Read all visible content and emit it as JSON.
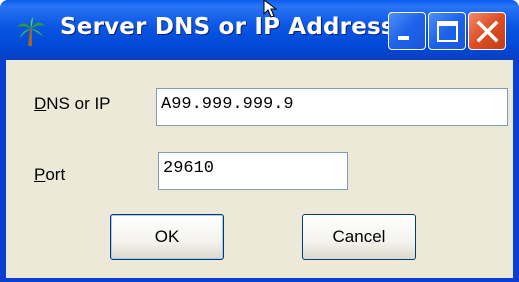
{
  "window": {
    "title": "Server DNS or IP Address",
    "icon": "palm-tree-icon"
  },
  "titlebar_buttons": {
    "minimize": "minimize-icon",
    "maximize": "maximize-icon",
    "close": "close-icon"
  },
  "form": {
    "dns_label_mnemonic": "D",
    "dns_label_rest": "NS or IP",
    "dns_value": "A99.999.999.9",
    "port_label_mnemonic": "P",
    "port_label_rest": "ort",
    "port_value": "29610"
  },
  "buttons": {
    "ok_label": "OK",
    "cancel_label": "Cancel"
  },
  "colors": {
    "titlebar": "#0a55e3",
    "client": "#ece9d8",
    "close_button": "#dd4d25"
  }
}
